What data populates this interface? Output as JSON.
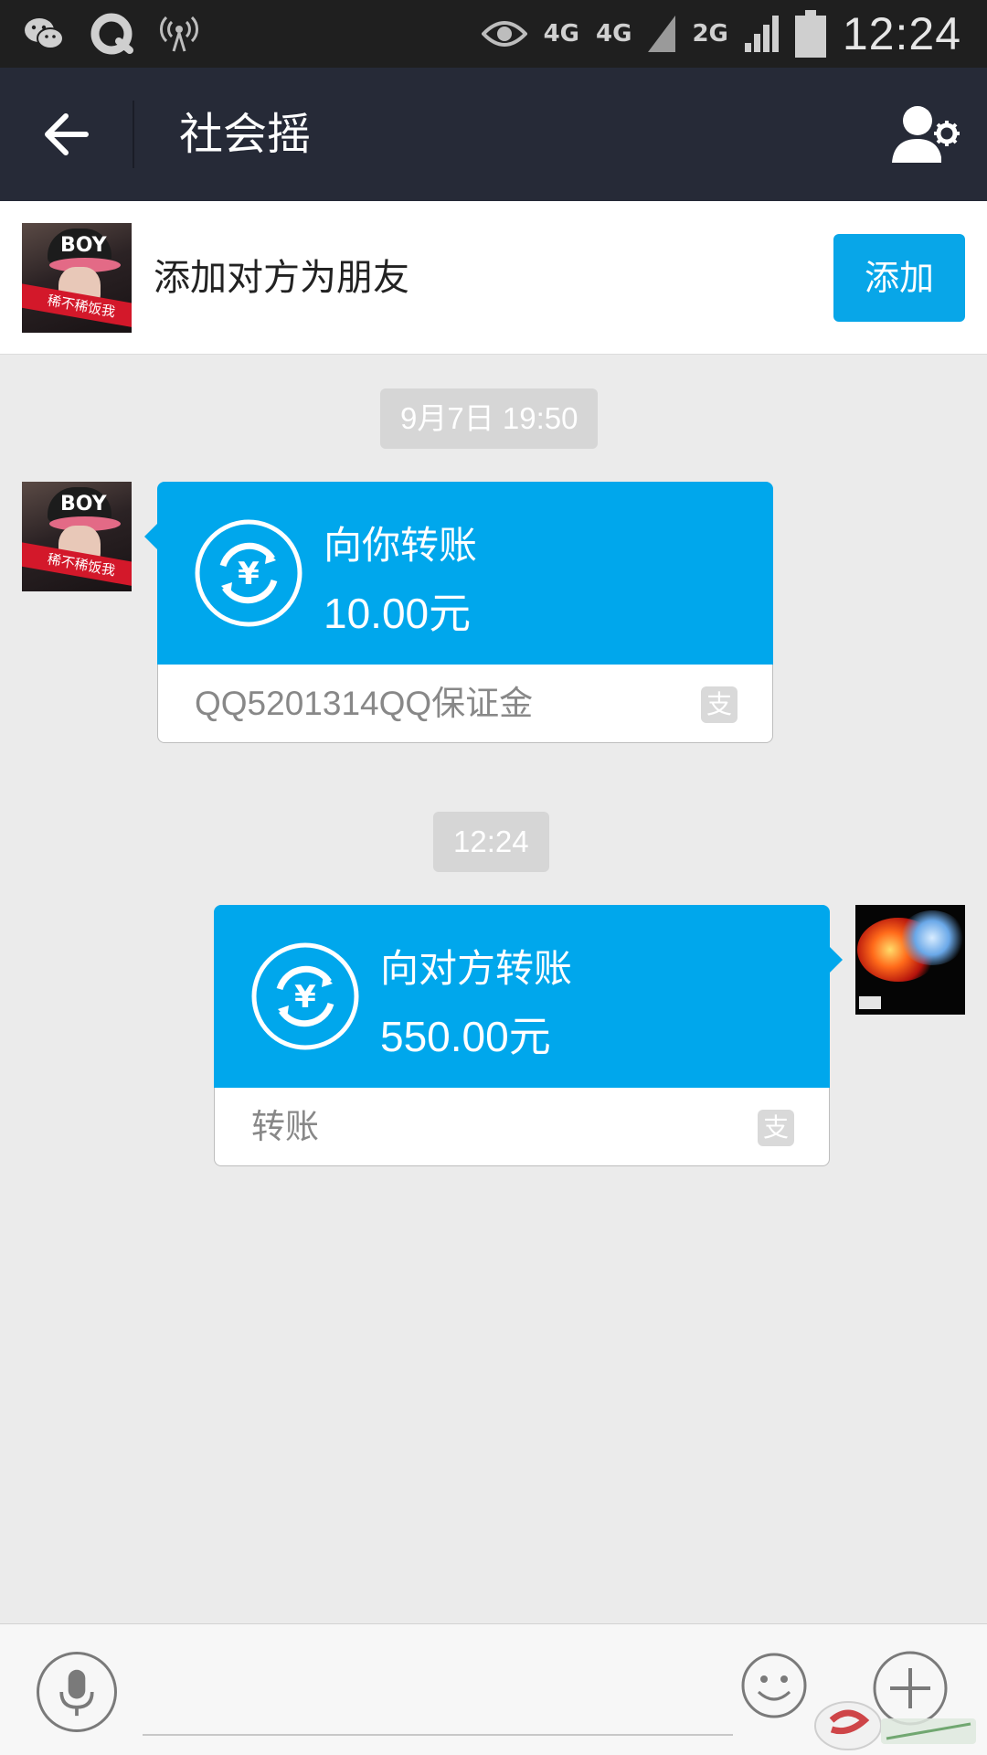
{
  "status_bar": {
    "time": "12:24",
    "net1": "4G",
    "net2": "4G",
    "net3": "2G",
    "icons": [
      "wechat-icon",
      "qq-icon",
      "hotspot-icon",
      "eye-icon",
      "signal-icon",
      "battery-icon"
    ]
  },
  "title_bar": {
    "title": "社会摇",
    "back_icon": "arrow-left-icon",
    "settings_icon": "user-settings-icon"
  },
  "banner": {
    "text": "添加对方为朋友",
    "add_label": "添加",
    "avatar_text": "BOY",
    "avatar_sash": "稀不稀饭我"
  },
  "chat": {
    "timestamps": [
      "9月7日 19:50",
      "12:24"
    ],
    "messages": [
      {
        "direction": "incoming",
        "title": "向你转账",
        "amount": "10.00元",
        "note": "QQ5201314QQ保证金",
        "pay_icon": "支"
      },
      {
        "direction": "outgoing",
        "title": "向对方转账",
        "amount": "550.00元",
        "note": "转账",
        "pay_icon": "支"
      }
    ]
  },
  "input_bar": {
    "icons": [
      "microphone-icon",
      "emoji-icon",
      "plus-icon"
    ]
  },
  "colors": {
    "accent": "#00a7ec",
    "titlebar": "#262a37",
    "background": "#ebebeb"
  }
}
